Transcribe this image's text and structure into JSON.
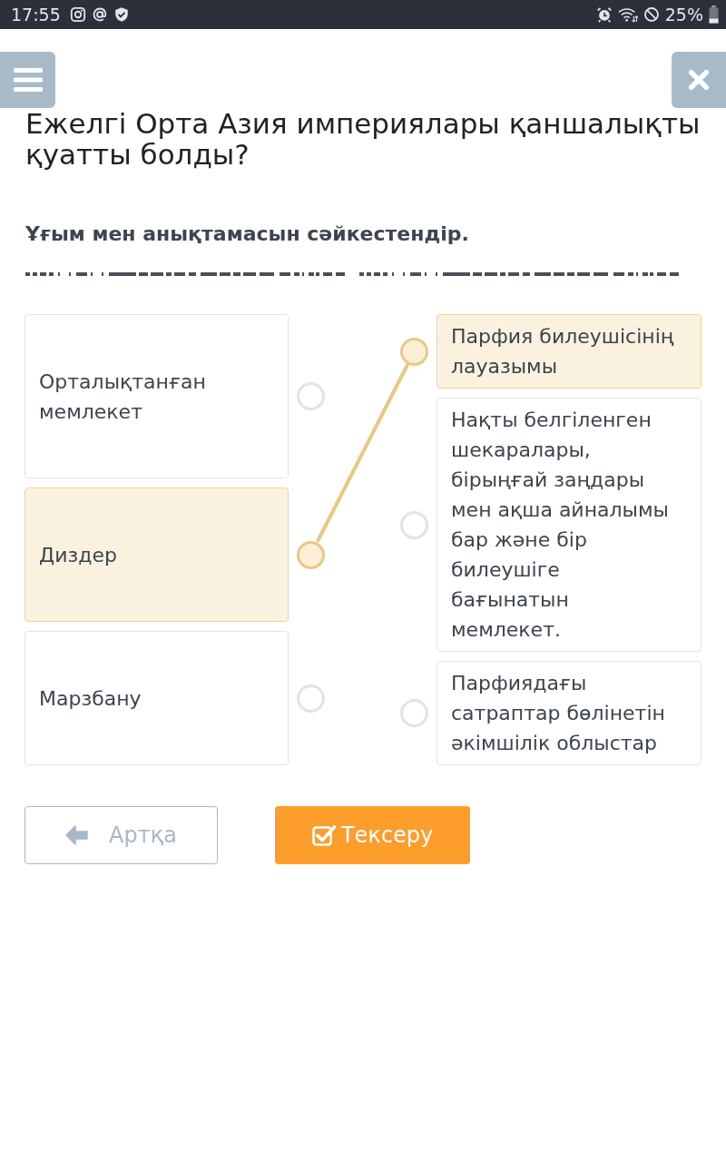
{
  "status_bar": {
    "time": "17:55",
    "battery": "25%"
  },
  "header": {
    "title": "Ежелгі Орта Азия империялары қаншалықты қуатты болды?"
  },
  "instruction": "Ұғым мен анықтамасын сәйкестендір.",
  "matching": {
    "terms": [
      {
        "text": "Орталықтанған мемлекет",
        "selected": false
      },
      {
        "text": "Диздер",
        "selected": true
      },
      {
        "text": "Марзбану",
        "selected": false
      }
    ],
    "definitions": [
      {
        "text": "Парфия билеушісінің лауазымы",
        "selected": true
      },
      {
        "text": "Нақты белгіленген шекаралары, бірыңғай заңдары мен ақша айналымы бар және бір билеушіге бағынатын мемлекет.",
        "selected": false
      },
      {
        "text": "Парфиядағы сатраптар бөлінетін әкімшілік облыстар",
        "selected": false
      }
    ]
  },
  "buttons": [
    {
      "kind": "back",
      "label": "Артқа",
      "disabled": true
    },
    {
      "kind": "check",
      "label": "Тексеру",
      "disabled": false
    }
  ]
}
